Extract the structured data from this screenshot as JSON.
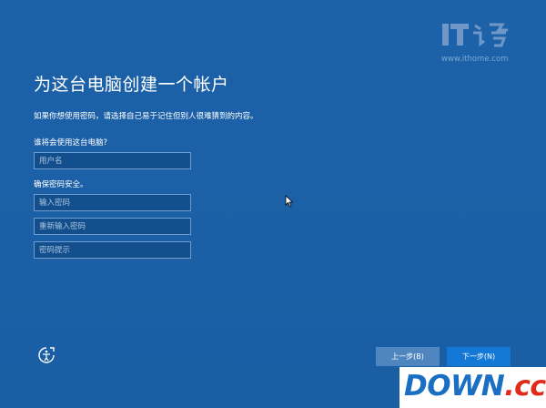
{
  "setup": {
    "title": "为这台电脑创建一个帐户",
    "subtitle": "如果你想使用密码，请选择自己易于记住但别人很难猜到的内容。",
    "who_label": "谁将会使用这台电脑?",
    "username_placeholder": "用户名",
    "secure_label": "确保密码安全。",
    "password_placeholder": "输入密码",
    "password_confirm_placeholder": "重新输入密码",
    "password_hint_placeholder": "密码提示"
  },
  "footer": {
    "back_label": "上一步(B)",
    "next_label": "下一步(N)"
  },
  "watermarks": {
    "ithome_logo_text": "IT",
    "ithome_url": "www.ithome.com",
    "down_text": "DOWN",
    "down_suffix": ".cc"
  },
  "colors": {
    "background": "#1a5fa6",
    "field_background": "#134f8c",
    "next_button": "#1478d6",
    "back_button": "#4f86c0"
  }
}
